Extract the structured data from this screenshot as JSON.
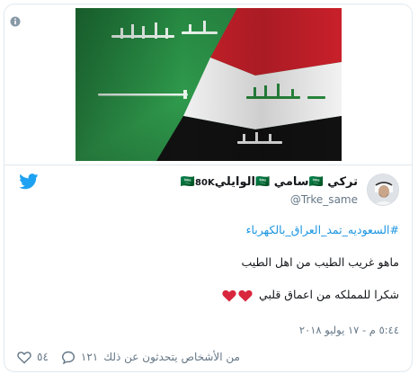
{
  "tweet": {
    "display_name": "تركي 🇸🇦سامي 🇸🇦الوايلي🇸🇦",
    "verified_suffix": "80K",
    "handle": "@Trke_same",
    "hashtag": "#السعوديه_تمد_العراق_بالكهرباء",
    "line1": "ماهو غريب الطيب من اهل الطيب",
    "line2": "شكرا للمملكه من اعماق قلبي",
    "timestamp": "٥:٤٤ م - ١٧ يوليو ٢٠١٨",
    "likes_count": "٥٤",
    "replies_count": "١٢١",
    "replies_text": "من الأشخاص يتحدثون عن ذلك"
  },
  "media": {
    "image_subject": "saudi-iraq-flags-image"
  },
  "colors": {
    "accent": "#1da1f2",
    "heart_red": "#d8263d",
    "link": "#1b95e0",
    "muted": "#657786"
  }
}
